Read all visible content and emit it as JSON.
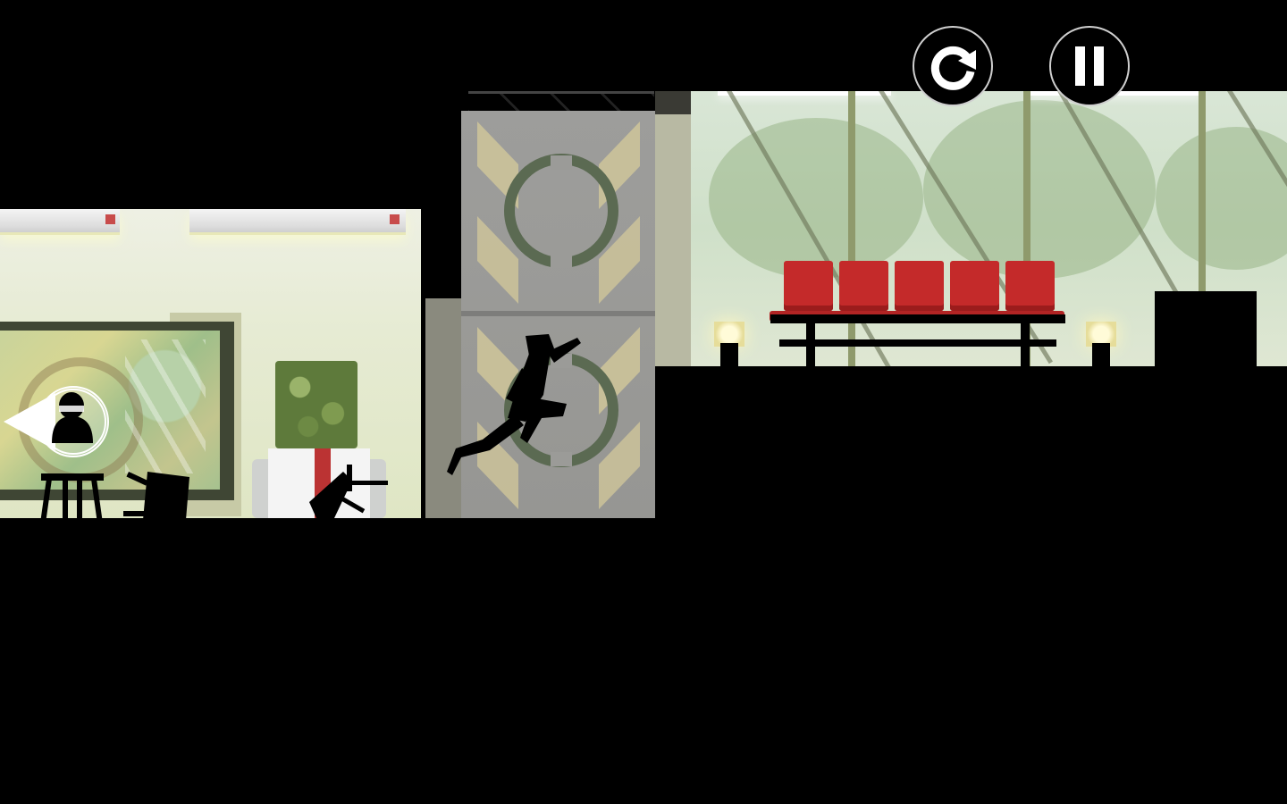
{
  "scene": {
    "name": "parkour-chase",
    "colors": {
      "background": "#000000",
      "seat_red": "#c42a2a",
      "plant_green": "#5e7a3b",
      "tower_gray": "#9a9a97"
    }
  },
  "hud": {
    "restart_icon": "restart-icon",
    "pause_icon": "pause-icon",
    "back_icon": "back-arrow-icon"
  },
  "characters": {
    "runner": "runner-silhouette",
    "hunter": "hunter-silhouette"
  }
}
